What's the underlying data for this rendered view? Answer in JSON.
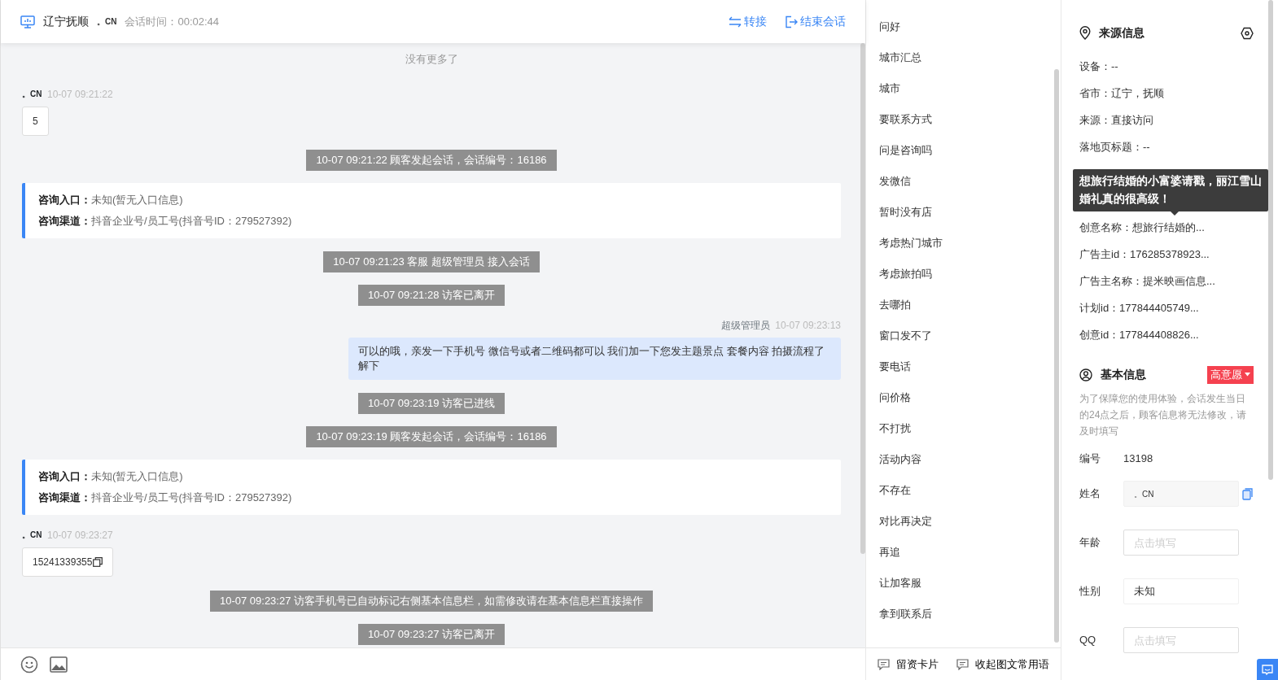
{
  "header": {
    "location": "辽宁抚顺",
    "visitor": "。CN",
    "session_time": "会话时间：00:02:44",
    "actions": [
      {
        "kind": "transfer",
        "label": "转接"
      },
      {
        "kind": "end",
        "label": "结束会话"
      }
    ]
  },
  "chat": {
    "top_note": "没有更多了",
    "messages": [
      {
        "kind": "visitor",
        "name": "。CN",
        "time": "10-07 09:21:22",
        "text": "5",
        "copy": false
      },
      {
        "kind": "notice",
        "text": "10-07 09:21:22 顾客发起会话，会话编号：16186"
      },
      {
        "kind": "entry",
        "rows": [
          {
            "label": "咨询入口：",
            "value": "未知(暂无入口信息)"
          },
          {
            "label": "咨询渠道：",
            "value": "抖音企业号/员工号(抖音号ID：279527392)"
          }
        ]
      },
      {
        "kind": "notice",
        "text": "10-07 09:21:23 客服 超级管理员 接入会话"
      },
      {
        "kind": "notice",
        "text": "10-07 09:21:28 访客已离开"
      },
      {
        "kind": "agent",
        "name": "超级管理员",
        "time": "10-07 09:23:13",
        "text": "可以的哦，亲发一下手机号 微信号或者二维码都可以 我们加一下您发主题景点 套餐内容 拍摄流程了解下"
      },
      {
        "kind": "notice",
        "text": "10-07 09:23:19 访客已进线"
      },
      {
        "kind": "notice",
        "text": "10-07 09:23:19 顾客发起会话，会话编号：16186"
      },
      {
        "kind": "entry",
        "rows": [
          {
            "label": "咨询入口：",
            "value": "未知(暂无入口信息)"
          },
          {
            "label": "咨询渠道：",
            "value": "抖音企业号/员工号(抖音号ID：279527392)"
          }
        ]
      },
      {
        "kind": "visitor",
        "name": "。CN",
        "time": "10-07 09:23:27",
        "text": "15241339355",
        "copy": true
      },
      {
        "kind": "notice",
        "text": "10-07 09:23:27 访客手机号已自动标记右侧基本信息栏，如需修改请在基本信息栏直接操作"
      },
      {
        "kind": "notice",
        "text": "10-07 09:23:27 访客已离开"
      }
    ]
  },
  "phrases": {
    "items": [
      "问好",
      "城市汇总",
      "城市",
      "要联系方式",
      "问是咨询吗",
      "发微信",
      "暂时没有店",
      "考虑热门城市",
      "考虑旅拍吗",
      "去哪拍",
      "窗口发不了",
      "要电话",
      "问价格",
      "不打扰",
      "活动内容",
      "不存在",
      "对比再决定",
      "再追",
      "让加客服",
      "拿到联系后"
    ],
    "footer": [
      "留资卡片",
      "收起图文常用语"
    ]
  },
  "source_info": {
    "title": "来源信息",
    "fields": [
      "设备：--",
      "省市：辽宁，抚顺",
      "来源：直接访问",
      "落地页标题：--",
      "创意名称：想旅行结婚的...",
      "广告主id：176285378923...",
      "广告主名称：提米映画信息...",
      "计划id：177844405749...",
      "创意id：177844408826..."
    ],
    "tooltip": "想旅行结婚的小富婆请戳，丽江雪山婚礼真的很高级！"
  },
  "basic_info": {
    "title": "基本信息",
    "tag": "高意愿",
    "note": "为了保障您的使用体验，会话发生当日的24点之后，顾客信息将无法修改，请及时填写",
    "fields": [
      {
        "kind": "text",
        "label": "编号",
        "value": "13198"
      },
      {
        "kind": "readonly",
        "label": "姓名",
        "value": "。CN"
      },
      {
        "kind": "input",
        "label": "年龄",
        "placeholder": "点击填写"
      },
      {
        "kind": "input",
        "label": "性别",
        "value": "未知"
      },
      {
        "kind": "input",
        "label": "QQ",
        "placeholder": "点击填写"
      }
    ]
  }
}
